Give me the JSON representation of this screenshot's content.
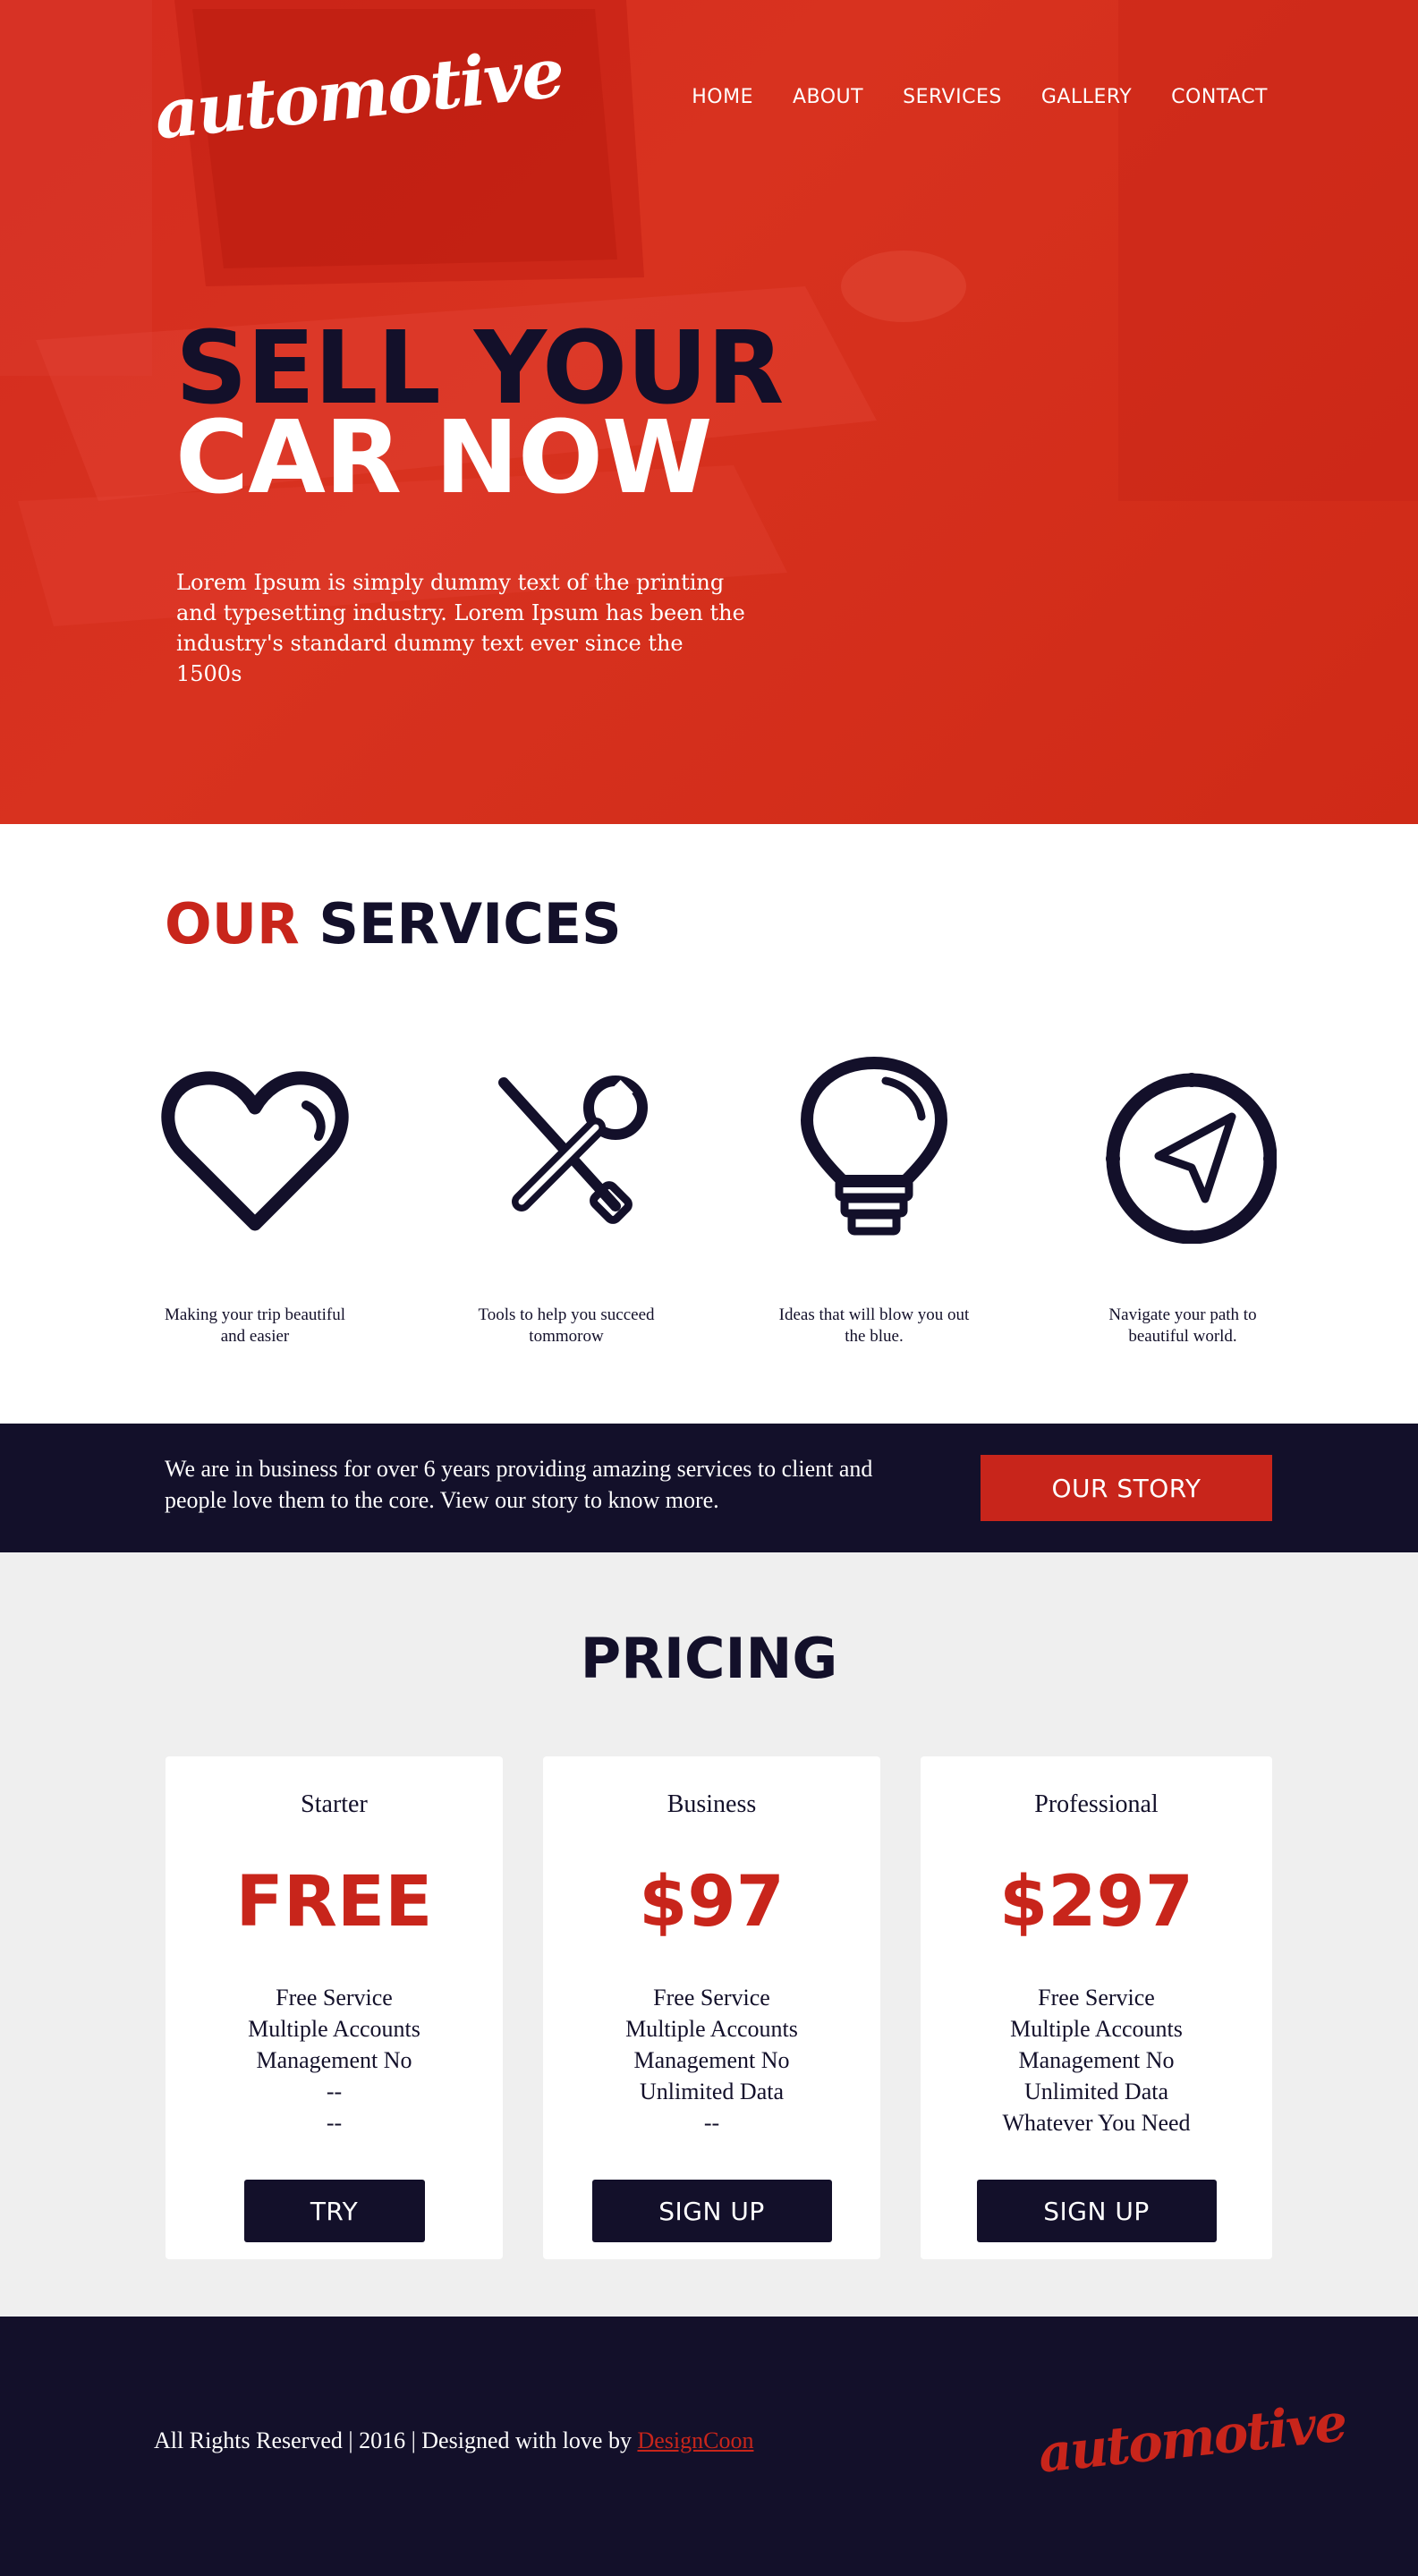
{
  "colors": {
    "accent": "#c8251b",
    "dark": "#13102a",
    "hero": "#d42c1f",
    "light": "#efefef"
  },
  "header": {
    "logo": "automotive",
    "nav": [
      "HOME",
      "ABOUT",
      "SERVICES",
      "GALLERY",
      "CONTACT"
    ]
  },
  "hero": {
    "title_line1": "SELL YOUR",
    "title_line2": "CAR NOW",
    "text": "Lorem Ipsum is simply dummy text of the printing and typesetting industry. Lorem Ipsum has been the industry's standard dummy text ever since the 1500s"
  },
  "services": {
    "title_our": "OUR",
    "title_services": "SERVICES",
    "items": [
      {
        "icon": "heart-icon",
        "caption": "Making your trip beautiful and easier"
      },
      {
        "icon": "tools-icon",
        "caption": "Tools to help you succeed tommorow"
      },
      {
        "icon": "lightbulb-icon",
        "caption": "Ideas that will blow you out the blue."
      },
      {
        "icon": "compass-icon",
        "caption": "Navigate your path to beautiful world."
      }
    ]
  },
  "story": {
    "text": "We are in business for over 6 years providing amazing services to client and people love them to the core. View our story to know more.",
    "button": "OUR STORY"
  },
  "pricing": {
    "title": "PRICING",
    "plans": [
      {
        "name": "Starter",
        "price": "FREE",
        "features": [
          "Free Service",
          "Multiple Accounts",
          "Management No",
          "--",
          "--"
        ],
        "cta": "TRY"
      },
      {
        "name": "Business",
        "price": "$97",
        "features": [
          "Free Service",
          "Multiple Accounts",
          "Management No",
          "Unlimited Data",
          "--"
        ],
        "cta": "SIGN UP"
      },
      {
        "name": "Professional",
        "price": "$297",
        "features": [
          "Free Service",
          "Multiple Accounts",
          "Management No",
          "Unlimited Data",
          "Whatever You Need"
        ],
        "cta": "SIGN UP"
      }
    ]
  },
  "footer": {
    "text": "All Rights Reserved | 2016 | Designed with love by",
    "brand": "DesignCoon",
    "logo": "automotive"
  }
}
